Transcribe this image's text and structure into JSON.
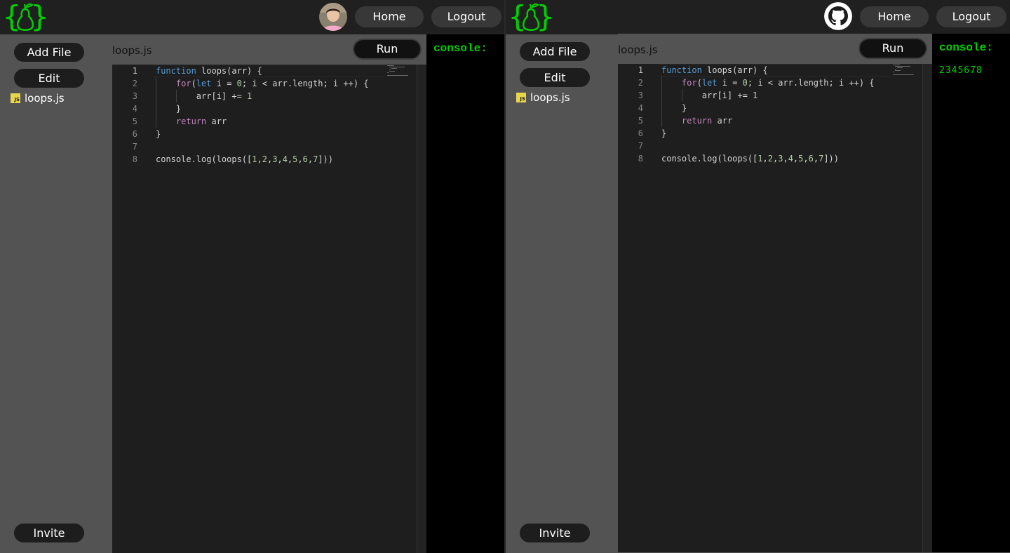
{
  "colors": {
    "accent_green": "#00d000",
    "topbar": "#202020",
    "sidebar": "#535353",
    "editor_bg": "#1e1e1e",
    "js_badge": "#e8d44d"
  },
  "windows": [
    {
      "avatar": "user-photo",
      "nav": {
        "home": "Home",
        "logout": "Logout"
      },
      "sidebar": {
        "add_file": "Add File",
        "edit": "Edit",
        "invite": "Invite",
        "files": [
          {
            "icon": "js",
            "name": "loops.js"
          }
        ]
      },
      "editor": {
        "filename": "loops.js",
        "run": "Run"
      },
      "console": {
        "title": "console:",
        "output": ""
      }
    },
    {
      "avatar": "github-icon",
      "nav": {
        "home": "Home",
        "logout": "Logout"
      },
      "sidebar": {
        "add_file": "Add File",
        "edit": "Edit",
        "invite": "Invite",
        "files": [
          {
            "icon": "js",
            "name": "loops.js"
          }
        ]
      },
      "editor": {
        "filename": "loops.js",
        "run": "Run"
      },
      "console": {
        "title": "console:",
        "output": "2345678"
      }
    }
  ],
  "code": {
    "line_numbers": [
      "1",
      "2",
      "3",
      "4",
      "5",
      "6",
      "7",
      "8"
    ],
    "lines": [
      [
        {
          "t": "kw",
          "v": "function"
        },
        {
          "t": "",
          "v": " loops(arr) {"
        }
      ],
      [
        {
          "t": "",
          "v": "    "
        },
        {
          "t": "ctl",
          "v": "for"
        },
        {
          "t": "",
          "v": "("
        },
        {
          "t": "kw",
          "v": "let"
        },
        {
          "t": "",
          "v": " i = "
        },
        {
          "t": "num",
          "v": "0"
        },
        {
          "t": "",
          "v": "; i < arr.length; i ++) {"
        }
      ],
      [
        {
          "t": "",
          "v": "        arr[i] += "
        },
        {
          "t": "num",
          "v": "1"
        }
      ],
      [
        {
          "t": "",
          "v": "    }"
        }
      ],
      [
        {
          "t": "",
          "v": "    "
        },
        {
          "t": "ctl",
          "v": "return"
        },
        {
          "t": "",
          "v": " arr"
        }
      ],
      [
        {
          "t": "",
          "v": "}"
        }
      ],
      [
        {
          "t": "",
          "v": ""
        }
      ],
      [
        {
          "t": "",
          "v": "console.log(loops(["
        },
        {
          "t": "num",
          "v": "1"
        },
        {
          "t": "",
          "v": ","
        },
        {
          "t": "num",
          "v": "2"
        },
        {
          "t": "",
          "v": ","
        },
        {
          "t": "num",
          "v": "3"
        },
        {
          "t": "",
          "v": ","
        },
        {
          "t": "num",
          "v": "4"
        },
        {
          "t": "",
          "v": ","
        },
        {
          "t": "num",
          "v": "5"
        },
        {
          "t": "",
          "v": ","
        },
        {
          "t": "num",
          "v": "6"
        },
        {
          "t": "",
          "v": ","
        },
        {
          "t": "num",
          "v": "7"
        },
        {
          "t": "",
          "v": "]))"
        }
      ]
    ]
  }
}
